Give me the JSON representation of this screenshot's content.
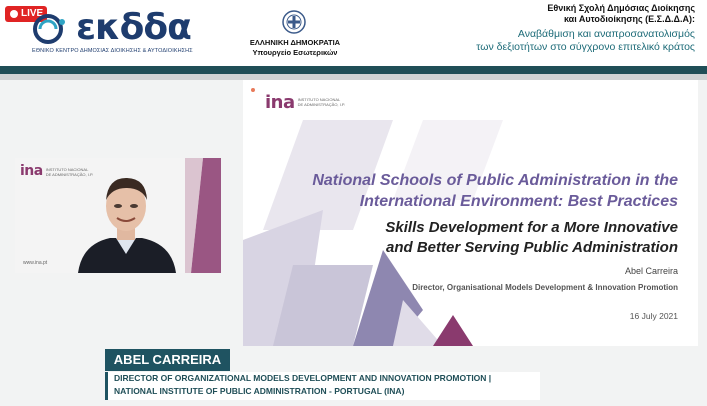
{
  "header": {
    "live_label": "LIVE",
    "brand_word": "εκδδα",
    "brand_subtitle": "ΕΘΝΙΚΟ ΚΕΝΤΡΟ ΔΗΜΟΣΙΑΣ ΔΙΟΙΚΗΣΗΣ & ΑΥΤΟΔΙΟΙΚΗΣΗΣ",
    "gov_name": "ΕΛΛΗΝΙΚΗ ΔΗΜΟΚΡΑΤΙΑ",
    "gov_ministry": "Υπουργείο Εσωτερικών",
    "school_line1": "Εθνική Σχολή Δημόσιας Διοίκησης",
    "school_line2": "και Αυτοδιοίκησης (Ε.Σ.Δ.Δ.Α):",
    "tagline_line1": "Αναβάθμιση και αναπροσανατολισμός",
    "tagline_line2": "των δεξιοτήτων στο σύγχρονο επιτελικό κράτος"
  },
  "speaker_panel": {
    "logo_word": "ina",
    "logo_small_1": "INSTITUTO NACIONAL",
    "logo_small_2": "DE ADMINISTRAÇÃO, I.P.",
    "url": "www.ina.pt"
  },
  "slide": {
    "logo_word": "ina",
    "logo_small_1": "INSTITUTO NACIONAL",
    "logo_small_2": "DE ADMINISTRAÇÃO, I.P.",
    "title_line1": "National Schools of Public Administration in the",
    "title_line2": "International Environment: Best Practices",
    "subtitle_line1": "Skills Development for a More Innovative",
    "subtitle_line2": "and Better Serving Public Administration",
    "presenter": "Abel Carreira",
    "role": "Director, Organisational Models Development & Innovation Promotion",
    "date": "16 July 2021"
  },
  "lower_third": {
    "name": "ABEL CARREIRA",
    "caption_line1": "DIRECTOR OF ORGANIZATIONAL MODELS DEVELOPMENT AND INNOVATION PROMOTION  |",
    "caption_line2": "NATIONAL INSTITUTE OF PUBLIC ADMINISTRATION - PORTUGAL (INA)"
  },
  "colors": {
    "live_red": "#e02424",
    "brand_blue": "#1e3c6e",
    "teal": "#1f4e57",
    "tagline_teal": "#1d6b78",
    "slide_title_purple": "#6a5b9a",
    "ina_magenta": "#8a3a6e"
  }
}
